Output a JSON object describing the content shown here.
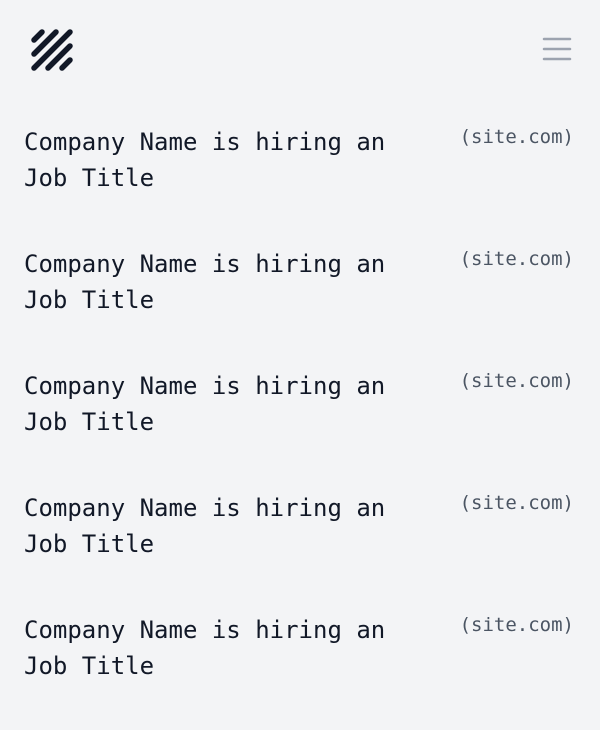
{
  "header": {
    "logo_icon": "diagonal-stripes-logo-icon",
    "menu_icon": "hamburger-menu-icon"
  },
  "jobs": [
    {
      "company": "Company Name",
      "connector": "is hiring an",
      "title": "Job Title",
      "site": "(site.com)"
    },
    {
      "company": "Company Name",
      "connector": "is hiring an",
      "title": "Job Title",
      "site": "(site.com)"
    },
    {
      "company": "Company Name",
      "connector": "is hiring an",
      "title": "Job Title",
      "site": "(site.com)"
    },
    {
      "company": "Company Name",
      "connector": "is hiring an",
      "title": "Job Title",
      "site": "(site.com)"
    },
    {
      "company": "Company Name",
      "connector": "is hiring an",
      "title": "Job Title",
      "site": "(site.com)"
    }
  ],
  "colors": {
    "background": "#f3f4f6",
    "text": "#111827",
    "muted": "#4b5563",
    "menu_icon": "#9ca3af"
  }
}
